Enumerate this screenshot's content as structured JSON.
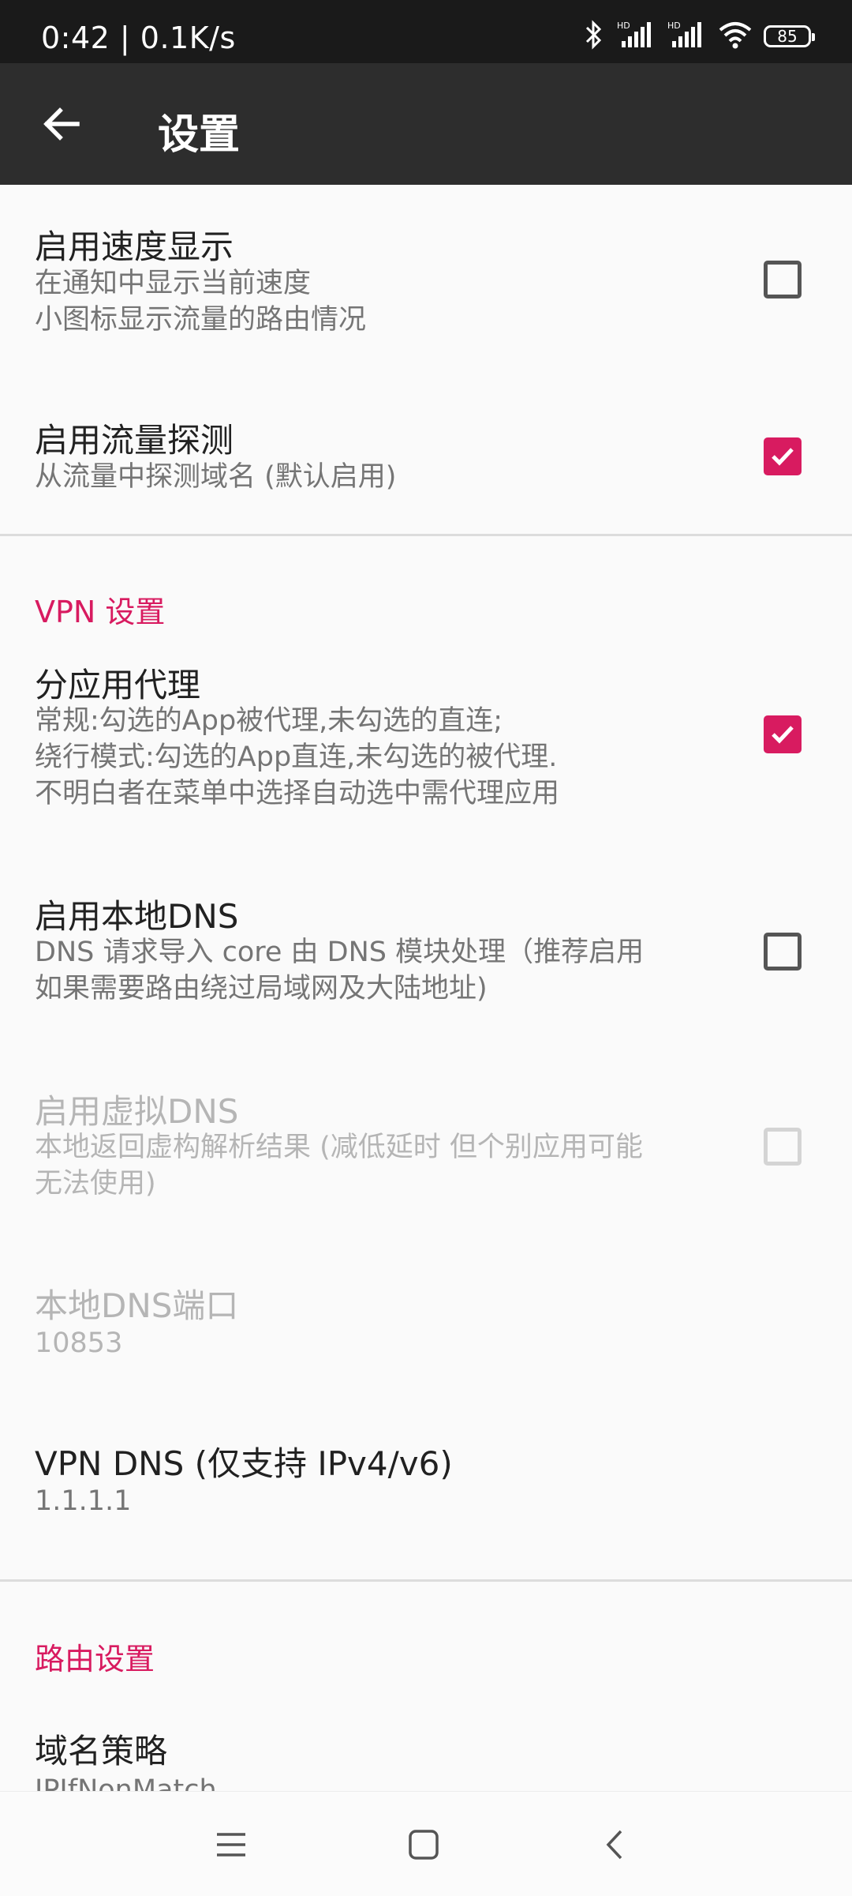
{
  "status_bar": {
    "time_speed": "0:42 | 0.1K/s",
    "battery": "85",
    "icons": [
      "bluetooth-icon",
      "hd-signal-icon",
      "hd-signal-icon",
      "wifi-icon",
      "battery-icon"
    ]
  },
  "toolbar": {
    "title": "设置",
    "back_icon": "arrow-left-icon"
  },
  "prefs": {
    "speed_display": {
      "title": "启用速度显示",
      "summary_line1": "在通知中显示当前速度",
      "summary_line2": "小图标显示流量的路由情况",
      "checked": false
    },
    "sniffing": {
      "title": "启用流量探测",
      "summary": "从流量中探测域名 (默认启用)",
      "checked": true
    },
    "vpn_category": "VPN 设置",
    "per_app_proxy": {
      "title": "分应用代理",
      "summary_line1": "常规:勾选的App被代理,未勾选的直连;",
      "summary_line2": "绕行模式:勾选的App直连,未勾选的被代理.",
      "summary_line3": "不明白者在菜单中选择自动选中需代理应用",
      "checked": true
    },
    "local_dns": {
      "title": "启用本地DNS",
      "summary_line1": "DNS 请求导入 core 由 DNS 模块处理（推荐启用",
      "summary_line2": "如果需要路由绕过局域网及大陆地址)",
      "checked": false
    },
    "fake_dns": {
      "title": "启用虚拟DNS",
      "summary_line1": "本地返回虚构解析结果 (减低延时 但个别应用可能",
      "summary_line2": "无法使用)",
      "checked": false,
      "enabled": false
    },
    "local_dns_port": {
      "title": "本地DNS端口",
      "value": "10853",
      "enabled": false
    },
    "vpn_dns": {
      "title": "VPN DNS (仅支持 IPv4/v6)",
      "value": "1.1.1.1"
    },
    "routing_category": "路由设置",
    "domain_strategy": {
      "title": "域名策略",
      "value": "IPIfNonMatch"
    }
  },
  "navbar": {
    "icons": [
      "menu-icon",
      "home-icon",
      "back-icon"
    ]
  },
  "colors": {
    "accent": "#d81b60",
    "toolbar": "#2d2d2d",
    "status_bar": "#1a1a1a"
  }
}
